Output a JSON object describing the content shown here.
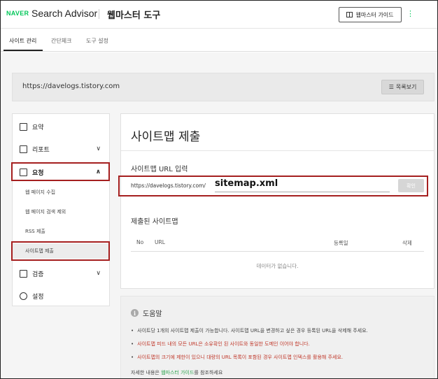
{
  "header": {
    "logo": "NAVER",
    "brand": "Search Advisor",
    "tool_title": "웹마스터 도구",
    "guide_button": "웹마스터 가이드",
    "more": "⋮"
  },
  "tabs": [
    {
      "label": "사이트 관리",
      "active": true
    },
    {
      "label": "간단체크",
      "active": false
    },
    {
      "label": "도구 설정",
      "active": false
    }
  ],
  "site": {
    "url": "https://davelogs.tistory.com",
    "list_button": "목록보기"
  },
  "sidebar": {
    "items": [
      {
        "label": "요약",
        "icon": "document-icon"
      },
      {
        "label": "리포트",
        "icon": "chart-icon",
        "chevron": "∨"
      },
      {
        "label": "요청",
        "icon": "checkbox-icon",
        "chevron": "∧",
        "expanded": true
      },
      {
        "label": "검증",
        "icon": "swap-icon",
        "chevron": "∨"
      },
      {
        "label": "설정",
        "icon": "gear-icon"
      }
    ],
    "sub_items": [
      {
        "label": "웹 페이지 수집"
      },
      {
        "label": "웹 페이지 검색 제외"
      },
      {
        "label": "RSS 제출"
      },
      {
        "label": "사이트맵 제출",
        "selected": true
      }
    ]
  },
  "main": {
    "title": "사이트맵 제출",
    "input_label": "사이트맵 URL 입력",
    "prefix": "https://davelogs.tistory.com/",
    "typed_value": "sitemap.xml",
    "confirm_button": "확인",
    "submitted_title": "제출된 사이트맵",
    "table": {
      "columns": [
        "No",
        "URL",
        "등록일",
        "삭제"
      ],
      "empty_text": "데이터가 없습니다."
    }
  },
  "help": {
    "title": "도움말",
    "items": [
      {
        "text": "사이트당 1개의 사이트맵 제출이 가능합니다. 사이트맵 URL을 변경하고 싶은 경우 등록된 URL을 삭제해 주세요.",
        "warn": false
      },
      {
        "text": "사이트맵 피드 내의 모든 URL은 소유확인 된 사이트와 동일한 도메인 이어야 합니다.",
        "warn": true
      },
      {
        "text": "사이트맵의 크기에 제한이 있으니 대량의 URL 목록이 포함된 경우 사이트맵 인덱스를 활용해 주세요.",
        "warn": true
      }
    ],
    "footer_prefix": "자세한 내용은 ",
    "footer_link": "웹마스터 가이드",
    "footer_suffix": "를 참조하세요"
  },
  "colors": {
    "naver_green": "#03c75a",
    "highlight_red": "#a51f1f",
    "warning_red": "#c0392b",
    "link_green": "#2ea44f"
  }
}
